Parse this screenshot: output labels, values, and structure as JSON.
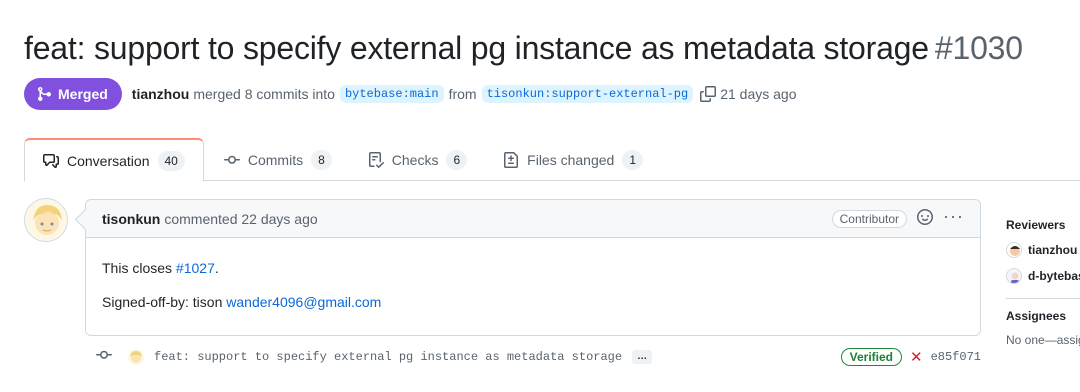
{
  "pr": {
    "title": "feat: support to specify external pg instance as metadata storage",
    "number": "#1030",
    "state_label": "Merged",
    "merged_by": "tianzhou",
    "merge_text": "merged 8 commits into",
    "base_branch": "bytebase:main",
    "from_text": "from",
    "head_branch": "tisonkun:support-external-pg",
    "time_ago": "21 days ago"
  },
  "tabs": [
    {
      "label": "Conversation",
      "count": "40",
      "icon": "comment-discussion-icon"
    },
    {
      "label": "Commits",
      "count": "8",
      "icon": "git-commit-icon"
    },
    {
      "label": "Checks",
      "count": "6",
      "icon": "checklist-icon"
    },
    {
      "label": "Files changed",
      "count": "1",
      "icon": "file-diff-icon"
    }
  ],
  "comment": {
    "author": "tisonkun",
    "action": "commented 22 days ago",
    "role": "Contributor",
    "body_prefix": "This closes",
    "issue_link": "#1027",
    "body_suffix": ".",
    "signoff_prefix": "Signed-off-by: tison",
    "email": "wander4096@gmail.com"
  },
  "commit": {
    "message": "feat: support to specify external pg instance as metadata storage",
    "expander": "…",
    "verified_label": "Verified",
    "status": "✕",
    "sha": "e85f071"
  },
  "sidebar": {
    "reviewers_heading": "Reviewers",
    "reviewers": [
      "tianzhou",
      "d-bytebase"
    ],
    "assignees_heading": "Assignees",
    "assignees_text": "No one—assign yourself"
  },
  "colors": {
    "merged": "#8250df",
    "link": "#0969da",
    "verified": "#1a7f37",
    "failed": "#d1242f",
    "active_tab_accent": "#fd8c73"
  }
}
